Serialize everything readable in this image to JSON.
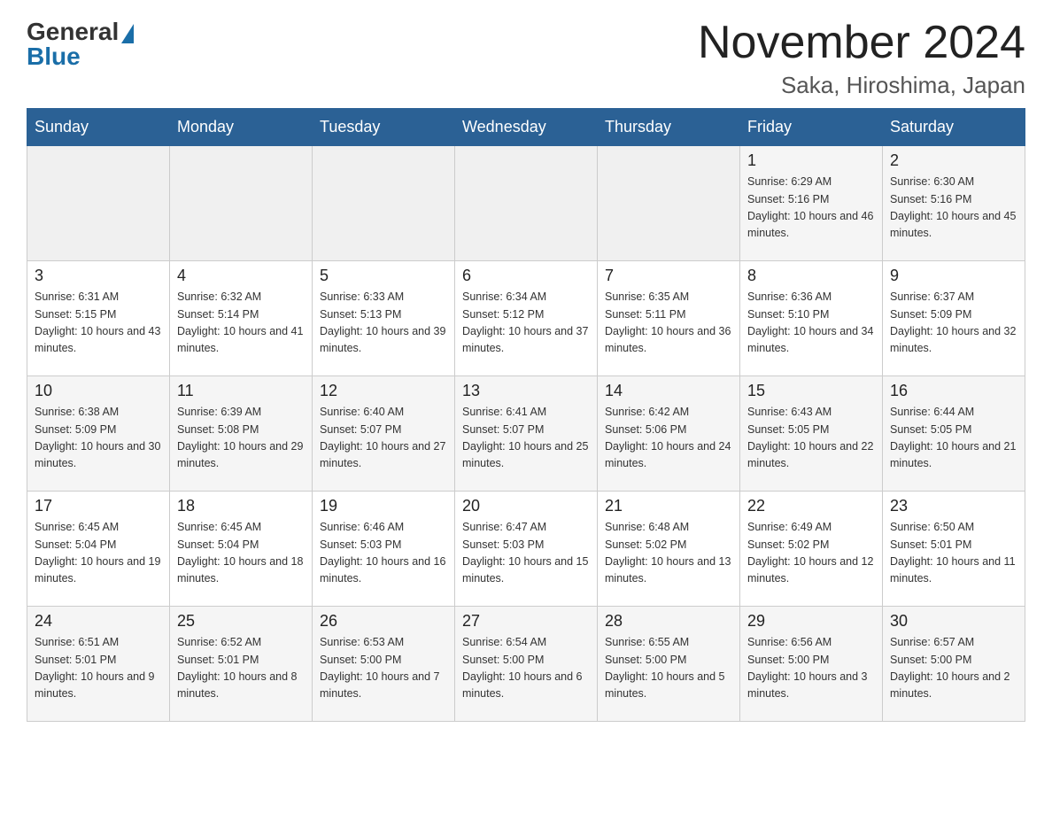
{
  "logo": {
    "general": "General",
    "blue": "Blue",
    "triangle_color": "#1a6ea8"
  },
  "header": {
    "title": "November 2024",
    "subtitle": "Saka, Hiroshima, Japan"
  },
  "weekdays": [
    "Sunday",
    "Monday",
    "Tuesday",
    "Wednesday",
    "Thursday",
    "Friday",
    "Saturday"
  ],
  "weeks": [
    [
      {
        "day": "",
        "info": ""
      },
      {
        "day": "",
        "info": ""
      },
      {
        "day": "",
        "info": ""
      },
      {
        "day": "",
        "info": ""
      },
      {
        "day": "",
        "info": ""
      },
      {
        "day": "1",
        "info": "Sunrise: 6:29 AM\nSunset: 5:16 PM\nDaylight: 10 hours and 46 minutes."
      },
      {
        "day": "2",
        "info": "Sunrise: 6:30 AM\nSunset: 5:16 PM\nDaylight: 10 hours and 45 minutes."
      }
    ],
    [
      {
        "day": "3",
        "info": "Sunrise: 6:31 AM\nSunset: 5:15 PM\nDaylight: 10 hours and 43 minutes."
      },
      {
        "day": "4",
        "info": "Sunrise: 6:32 AM\nSunset: 5:14 PM\nDaylight: 10 hours and 41 minutes."
      },
      {
        "day": "5",
        "info": "Sunrise: 6:33 AM\nSunset: 5:13 PM\nDaylight: 10 hours and 39 minutes."
      },
      {
        "day": "6",
        "info": "Sunrise: 6:34 AM\nSunset: 5:12 PM\nDaylight: 10 hours and 37 minutes."
      },
      {
        "day": "7",
        "info": "Sunrise: 6:35 AM\nSunset: 5:11 PM\nDaylight: 10 hours and 36 minutes."
      },
      {
        "day": "8",
        "info": "Sunrise: 6:36 AM\nSunset: 5:10 PM\nDaylight: 10 hours and 34 minutes."
      },
      {
        "day": "9",
        "info": "Sunrise: 6:37 AM\nSunset: 5:09 PM\nDaylight: 10 hours and 32 minutes."
      }
    ],
    [
      {
        "day": "10",
        "info": "Sunrise: 6:38 AM\nSunset: 5:09 PM\nDaylight: 10 hours and 30 minutes."
      },
      {
        "day": "11",
        "info": "Sunrise: 6:39 AM\nSunset: 5:08 PM\nDaylight: 10 hours and 29 minutes."
      },
      {
        "day": "12",
        "info": "Sunrise: 6:40 AM\nSunset: 5:07 PM\nDaylight: 10 hours and 27 minutes."
      },
      {
        "day": "13",
        "info": "Sunrise: 6:41 AM\nSunset: 5:07 PM\nDaylight: 10 hours and 25 minutes."
      },
      {
        "day": "14",
        "info": "Sunrise: 6:42 AM\nSunset: 5:06 PM\nDaylight: 10 hours and 24 minutes."
      },
      {
        "day": "15",
        "info": "Sunrise: 6:43 AM\nSunset: 5:05 PM\nDaylight: 10 hours and 22 minutes."
      },
      {
        "day": "16",
        "info": "Sunrise: 6:44 AM\nSunset: 5:05 PM\nDaylight: 10 hours and 21 minutes."
      }
    ],
    [
      {
        "day": "17",
        "info": "Sunrise: 6:45 AM\nSunset: 5:04 PM\nDaylight: 10 hours and 19 minutes."
      },
      {
        "day": "18",
        "info": "Sunrise: 6:45 AM\nSunset: 5:04 PM\nDaylight: 10 hours and 18 minutes."
      },
      {
        "day": "19",
        "info": "Sunrise: 6:46 AM\nSunset: 5:03 PM\nDaylight: 10 hours and 16 minutes."
      },
      {
        "day": "20",
        "info": "Sunrise: 6:47 AM\nSunset: 5:03 PM\nDaylight: 10 hours and 15 minutes."
      },
      {
        "day": "21",
        "info": "Sunrise: 6:48 AM\nSunset: 5:02 PM\nDaylight: 10 hours and 13 minutes."
      },
      {
        "day": "22",
        "info": "Sunrise: 6:49 AM\nSunset: 5:02 PM\nDaylight: 10 hours and 12 minutes."
      },
      {
        "day": "23",
        "info": "Sunrise: 6:50 AM\nSunset: 5:01 PM\nDaylight: 10 hours and 11 minutes."
      }
    ],
    [
      {
        "day": "24",
        "info": "Sunrise: 6:51 AM\nSunset: 5:01 PM\nDaylight: 10 hours and 9 minutes."
      },
      {
        "day": "25",
        "info": "Sunrise: 6:52 AM\nSunset: 5:01 PM\nDaylight: 10 hours and 8 minutes."
      },
      {
        "day": "26",
        "info": "Sunrise: 6:53 AM\nSunset: 5:00 PM\nDaylight: 10 hours and 7 minutes."
      },
      {
        "day": "27",
        "info": "Sunrise: 6:54 AM\nSunset: 5:00 PM\nDaylight: 10 hours and 6 minutes."
      },
      {
        "day": "28",
        "info": "Sunrise: 6:55 AM\nSunset: 5:00 PM\nDaylight: 10 hours and 5 minutes."
      },
      {
        "day": "29",
        "info": "Sunrise: 6:56 AM\nSunset: 5:00 PM\nDaylight: 10 hours and 3 minutes."
      },
      {
        "day": "30",
        "info": "Sunrise: 6:57 AM\nSunset: 5:00 PM\nDaylight: 10 hours and 2 minutes."
      }
    ]
  ]
}
